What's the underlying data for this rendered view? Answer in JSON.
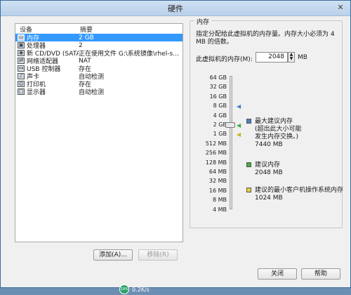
{
  "window": {
    "title": "硬件",
    "close_glyph": "✕"
  },
  "device_list": {
    "headers": {
      "device": "设备",
      "summary": "摘要"
    },
    "rows": [
      {
        "icon": "memory-icon",
        "name": "内存",
        "summary": "2 GB",
        "selected": true
      },
      {
        "icon": "processor-icon",
        "name": "处理器",
        "summary": "2"
      },
      {
        "icon": "cd-dvd-icon",
        "name": "新 CD/DVD (SATA)",
        "summary": "正在使用文件 G:\\系统镜像\\rhel-serv..."
      },
      {
        "icon": "network-adapter-icon",
        "name": "网络适配器",
        "summary": "NAT"
      },
      {
        "icon": "usb-controller-icon",
        "name": "USB 控制器",
        "summary": "存在"
      },
      {
        "icon": "sound-card-icon",
        "name": "声卡",
        "summary": "自动检测"
      },
      {
        "icon": "printer-icon",
        "name": "打印机",
        "summary": "存在"
      },
      {
        "icon": "display-icon",
        "name": "显示器",
        "summary": "自动检测"
      }
    ],
    "add_button": "添加(A)...",
    "remove_button": "移除(R)"
  },
  "memory": {
    "group_title": "内存",
    "description": "指定分配给此虚拟机的内存量。内存大小必须为 4 MB 的倍数。",
    "field_label": "此虚拟机的内存(M):",
    "value": "2048",
    "unit": "MB",
    "scale_labels": [
      "64 GB",
      "32 GB",
      "16 GB",
      "8 GB",
      "4 GB",
      "2 GB",
      "1 GB",
      "512 MB",
      "256 MB",
      "128 MB",
      "64 MB",
      "32 MB",
      "16 MB",
      "8 MB",
      "4 MB"
    ],
    "slider_level_label": "2 GB",
    "max_recommended": {
      "title": "最大建议内存",
      "note_line1": "(超出此大小可能",
      "note_line2": "发生内存交换。)",
      "value": "7440 MB",
      "color": "#4a7fc1"
    },
    "recommended": {
      "title": "建议内存",
      "value": "2048 MB",
      "color": "#3fae3f"
    },
    "guest_min": {
      "title": "建议的最小客户机操作系统内存",
      "value": "1024 MB",
      "color": "#e8d23a"
    }
  },
  "footer": {
    "ok_button": "关闭",
    "help_button": "帮助"
  },
  "taskbar": {
    "gauge": "19%",
    "speed": "0.2K/s"
  }
}
